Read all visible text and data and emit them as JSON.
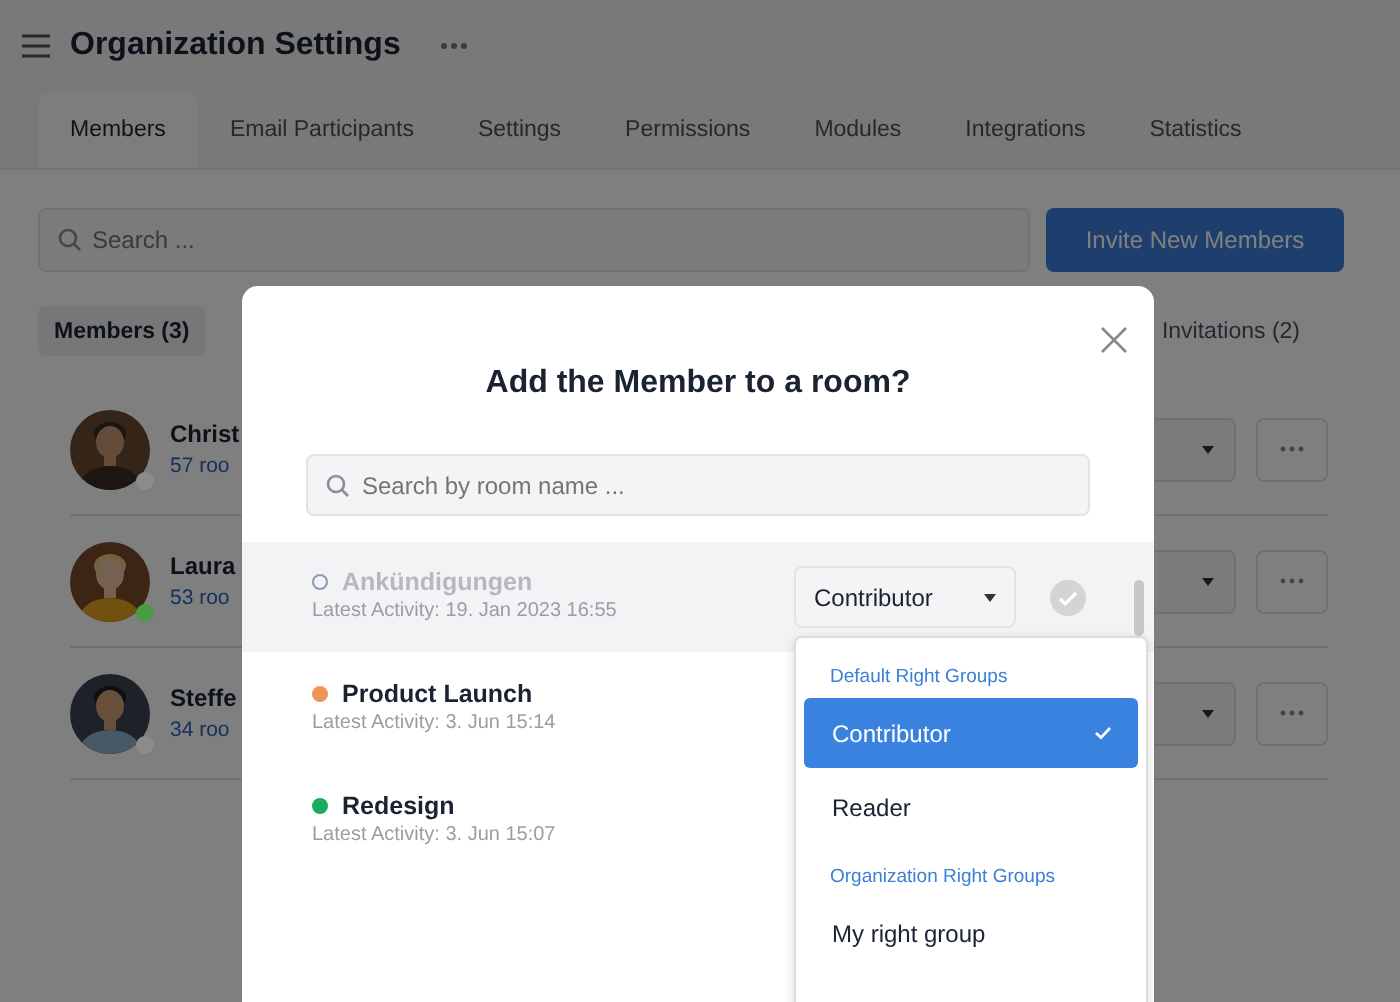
{
  "header": {
    "title": "Organization Settings"
  },
  "tabs": [
    {
      "label": "Members",
      "selected": true
    },
    {
      "label": "Email Participants",
      "selected": false
    },
    {
      "label": "Settings",
      "selected": false
    },
    {
      "label": "Permissions",
      "selected": false
    },
    {
      "label": "Modules",
      "selected": false
    },
    {
      "label": "Integrations",
      "selected": false
    },
    {
      "label": "Statistics",
      "selected": false
    }
  ],
  "search": {
    "placeholder": "Search ..."
  },
  "invite_button": "Invite New Members",
  "filters": [
    {
      "label": "Members (3)",
      "selected": true
    },
    {
      "label": "Invitations (2)",
      "selected": false
    }
  ],
  "members": [
    {
      "name": "Christ",
      "rooms": "57 roo",
      "color": "#8c8c8c"
    },
    {
      "name": "Laura",
      "rooms": "53 roo",
      "color": "#4a9a46"
    },
    {
      "name": "Steffe",
      "rooms": "34 roo",
      "color": "#8c8c8c"
    }
  ],
  "dialog": {
    "title": "Add the Member to a room?",
    "search_placeholder": "Search by room name ...",
    "rooms": [
      {
        "name": "Ankündigungen",
        "activity": "Latest Activity: 19. Jan 2023 16:55",
        "color": "#8a9bb5",
        "selected": true,
        "role": "Contributor"
      },
      {
        "name": "Product Launch",
        "activity": "Latest Activity: 3. Jun 15:14",
        "color": "#f0955a",
        "selected": false
      },
      {
        "name": "Redesign",
        "activity": "Latest Activity: 3. Jun 15:07",
        "color": "#1aaa60",
        "selected": false
      }
    ],
    "role_menu": [
      {
        "kind": "heading",
        "label": "Default Right Groups"
      },
      {
        "kind": "option",
        "label": "Contributor",
        "selected": true
      },
      {
        "kind": "option",
        "label": "Reader",
        "selected": false
      },
      {
        "kind": "heading",
        "label": "Organization Right Groups"
      },
      {
        "kind": "option",
        "label": "My right group",
        "selected": false
      }
    ]
  }
}
